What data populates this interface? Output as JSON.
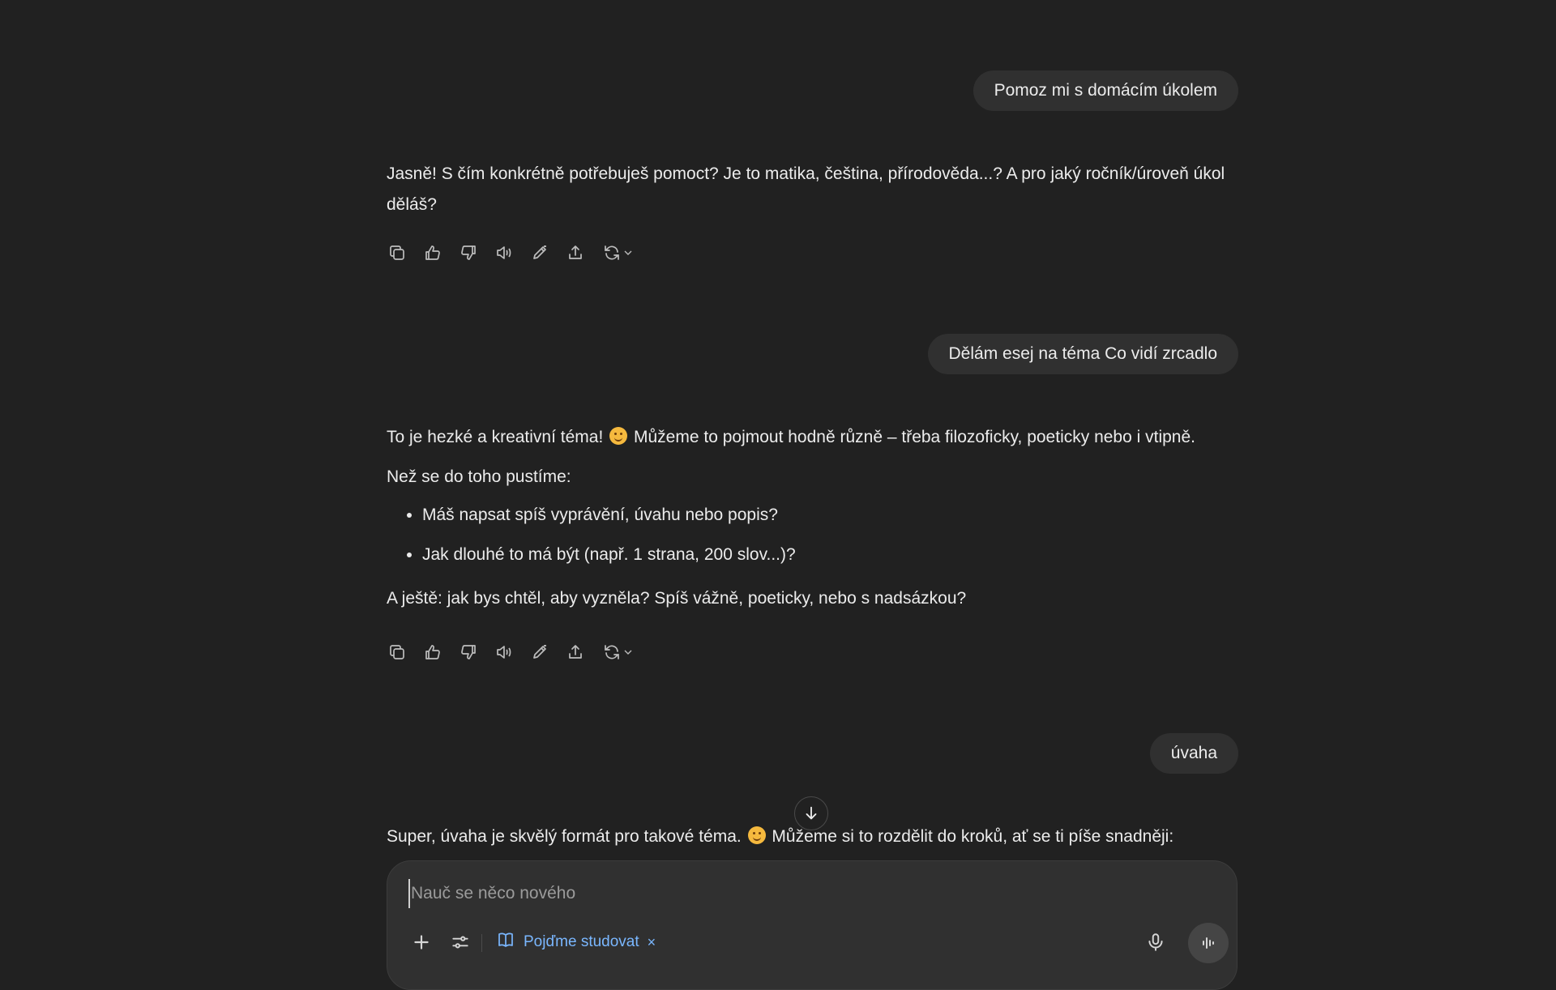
{
  "messages": {
    "user1": "Pomoz mi s domácím úkolem",
    "assistant1": "Jasně! S čím konkrétně potřebuješ pomoct? Je to matika, čeština, přírodověda...? A pro jaký ročník/úroveň úkol děláš?",
    "user2": "Dělám esej na téma Co vidí zrcadlo",
    "assistant2": {
      "p1_before": "To je hezké a kreativní téma!",
      "p1_after": "Můžeme to pojmout hodně různě – třeba filozoficky, poeticky nebo i vtipně.",
      "p2": "Než se do toho pustíme:",
      "bullets": [
        "Máš napsat spíš vyprávění, úvahu nebo popis?",
        "Jak dlouhé to má být (např. 1 strana, 200 slov...)?"
      ],
      "p3": "A ještě: jak bys chtěl, aby vyzněla? Spíš vážně, poeticky, nebo s nadsázkou?"
    },
    "user3": "úvaha",
    "assistant3": {
      "before": "Super, úvaha je skvělý formát pro takové téma.",
      "after": "Můžeme si to rozdělit do kroků, ať se ti píše snadněji:"
    }
  },
  "action_icons": [
    "copy-icon",
    "thumbs-up-icon",
    "thumbs-down-icon",
    "read-aloud-icon",
    "edit-icon",
    "share-icon",
    "regenerate-icon"
  ],
  "composer": {
    "placeholder": "Nauč se něco nového",
    "study_chip_label": "Pojďme studovat",
    "study_chip_close": "×"
  },
  "colors": {
    "background": "#212121",
    "bubble": "#303030",
    "text": "#ececec",
    "chip_accent": "#7ab7ff"
  }
}
